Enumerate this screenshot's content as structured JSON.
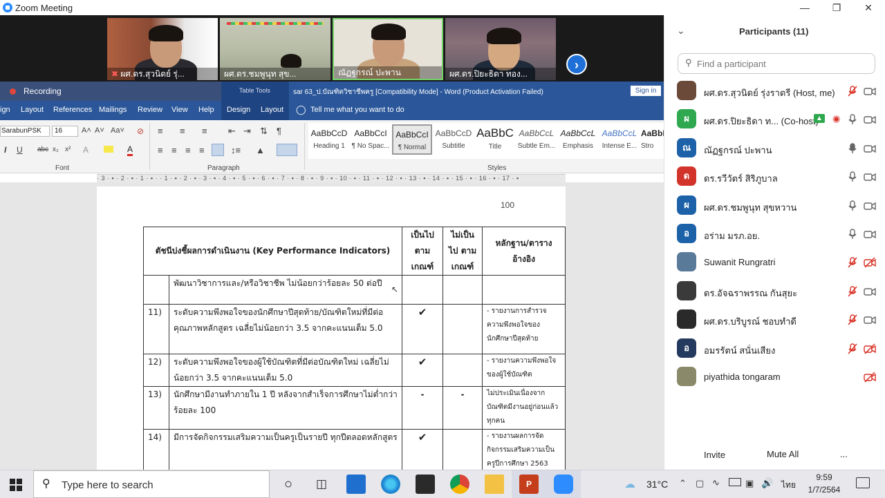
{
  "window": {
    "title": "Zoom Meeting"
  },
  "videos": [
    {
      "name": "ผศ.ดร.สุวนิดย์ รุ่..."
    },
    {
      "name": "ผศ.ดร.ชมพูนุท  สุข..."
    },
    {
      "name": "ณัฏฐกรณ์ ปะพาน"
    },
    {
      "name": "ผศ.ดร.ปิยะธิดา ทอง..."
    }
  ],
  "recording": {
    "label": "Recording"
  },
  "word": {
    "table_tools": "Table Tools",
    "doc_title": "sar 63_ป.บัณฑิตวิชาชีพครู [Compatibility Mode]  -  Word (Product Activation Failed)",
    "sign_in": "Sign in",
    "tabs": [
      "ign",
      "Layout",
      "References",
      "Mailings",
      "Review",
      "View",
      "Help",
      "Design",
      "Layout"
    ],
    "tell_me": "Tell me what you want to do",
    "font_name": "SarabunPSK",
    "font_size": "16",
    "group_font": "Font",
    "group_paragraph": "Paragraph",
    "group_styles": "Styles",
    "styles": [
      {
        "preview": "AaBbCcD",
        "name": "Heading 1"
      },
      {
        "preview": "AaBbCcI",
        "name": "¶ No Spac..."
      },
      {
        "preview": "AaBbCcI",
        "name": "¶ Normal"
      },
      {
        "preview": "AaBbCcD",
        "name": "Subtitle"
      },
      {
        "preview": "AaBbC",
        "name": "Title"
      },
      {
        "preview": "AaBbCcL",
        "name": "Subtle Em..."
      },
      {
        "preview": "AaBbCcL",
        "name": "Emphasis"
      },
      {
        "preview": "AaBbCcL",
        "name": "Intense E..."
      },
      {
        "preview": "AaBbI",
        "name": "Stro"
      }
    ],
    "ruler_text": "· 3 · ▪ · 2 · ▪ · 1 · ▪ ·   · 1 · ▪ · 2 · ▪ · 3 · ▪ · 4 · ▪ · 5 · ▪ · 6 · ▪ · 7 · ▪ · 8 · ▪ · 9 · ▪ · 10 · ▪ · 11 · ▪ · 12 · ▪ · 13 · ▪ · 14 · ▪ · 15 · ▪ · 16 · ▪ · 17 · ▪",
    "page_number": "100",
    "table": {
      "headers": [
        "ตัชนีบ่งชี้ผลการดำเนินงาน (Key Performance Indicators)",
        "เป็นไป ตาม เกณฑ์",
        "ไม่เป็นไป ตาม เกณฑ์",
        "หลักฐาน/ตาราง อ้างอิง"
      ],
      "rows": [
        {
          "num": "",
          "text": "พัฒนาวิชาการและ/หรือวิชาชีพ ไม่น้อยกว่าร้อยละ 50 ต่อปี",
          "met": "",
          "notmet": "",
          "ref": ""
        },
        {
          "num": "11)",
          "text": "ระดับความพึงพอใจของนักศึกษาปีสุดท้าย/บัณฑิตใหม่ที่มีต่อคุณภาพหลักสูตร เฉลี่ยไม่น้อยกว่า 3.5 จากคะแนนเต็ม 5.0",
          "met": "✔",
          "notmet": "",
          "ref": "- รายงานการสำรวจความพึงพอใจของนักศึกษาปีสุดท้าย"
        },
        {
          "num": "12)",
          "text": "ระดับความพึงพอใจของผู้ใช้บัณฑิตที่มีต่อบัณฑิตใหม่ เฉลี่ยไม่น้อยกว่า 3.5 จากคะแนนเต็ม 5.0",
          "met": "✔",
          "notmet": "",
          "ref": "- รายงานความพึงพอใจของผู้ใช้บัณฑิต"
        },
        {
          "num": "13)",
          "text": "นักศึกษามีงานทำภายใน 1 ปี หลังจากสำเร็จการศึกษาไม่ต่ำกว่าร้อยละ 100",
          "met": "-",
          "notmet": "-",
          "ref": "ไม่ประเมินเนื่องจากบัณฑิตมีงานอยู่ก่อนแล้วทุกคน"
        },
        {
          "num": "14)",
          "text": "มีการจัดกิจกรรมเสริมความเป็นครูเป็นรายปี ทุกปีตลอดหลักสูตร",
          "met": "✔",
          "notmet": "",
          "ref": "- รายงานผลการจัดกิจกรรมเสริมความเป็นครูปีการศึกษา 2563"
        }
      ]
    }
  },
  "participants": {
    "title": "Participants (11)",
    "search_placeholder": "Find a participant",
    "list": [
      {
        "name": "ผศ.ดร.สุวนิดย์ รุ่งราตรี (Host, me)",
        "avatar": "",
        "color": "#6b4a3a",
        "mic": "muted",
        "video": "on"
      },
      {
        "name": "ผศ.ดร.ปิยะธิดา ท...  (Co-host)",
        "avatar": "ผ",
        "color": "#2fa84f",
        "mic": "on",
        "video": "on"
      },
      {
        "name": "ณัฏฐกรณ์ ปะพาน",
        "avatar": "ณ",
        "color": "#1d62a8",
        "mic": "active",
        "video": "on"
      },
      {
        "name": "ดร.รวีวัตร์ สิริภูบาล",
        "avatar": "ด",
        "color": "#d2342b",
        "mic": "on",
        "video": "on"
      },
      {
        "name": "ผศ.ดร.ชมพูนุท  สุขหวาน",
        "avatar": "ผ",
        "color": "#1d62a8",
        "mic": "on",
        "video": "on"
      },
      {
        "name": "อร่าม มรภ.อย.",
        "avatar": "อ",
        "color": "#1d62a8",
        "mic": "on",
        "video": "on"
      },
      {
        "name": "Suwanit Rungratri",
        "avatar": "",
        "color": "#5a7a9a",
        "mic": "muted",
        "video": "off"
      },
      {
        "name": "ดร.อัจฉราพรรณ กันสุยะ",
        "avatar": "",
        "color": "#3a3a3a",
        "mic": "muted",
        "video": "on"
      },
      {
        "name": "ผศ.ดร.บริบูรณ์ ชอบทำดี",
        "avatar": "",
        "color": "#2a2a2a",
        "mic": "muted",
        "video": "on"
      },
      {
        "name": "อมรรัตน์  สนั่นเสียง",
        "avatar": "อ",
        "color": "#243a5e",
        "mic": "muted",
        "video": "off"
      },
      {
        "name": "piyathida tongaram",
        "avatar": "",
        "color": "#8a8a6a",
        "mic": "",
        "video": "off"
      }
    ],
    "invite": "Invite",
    "mute_all": "Mute All",
    "more": "..."
  },
  "taskbar": {
    "search_placeholder": "Type here to search",
    "temperature": "31°C",
    "language": "ไทย",
    "time": "9:59",
    "date": "1/7/2564"
  },
  "colors": {
    "word_blue": "#2b579a",
    "zoom_blue": "#2D8CFF",
    "mute_red": "#d93025"
  }
}
